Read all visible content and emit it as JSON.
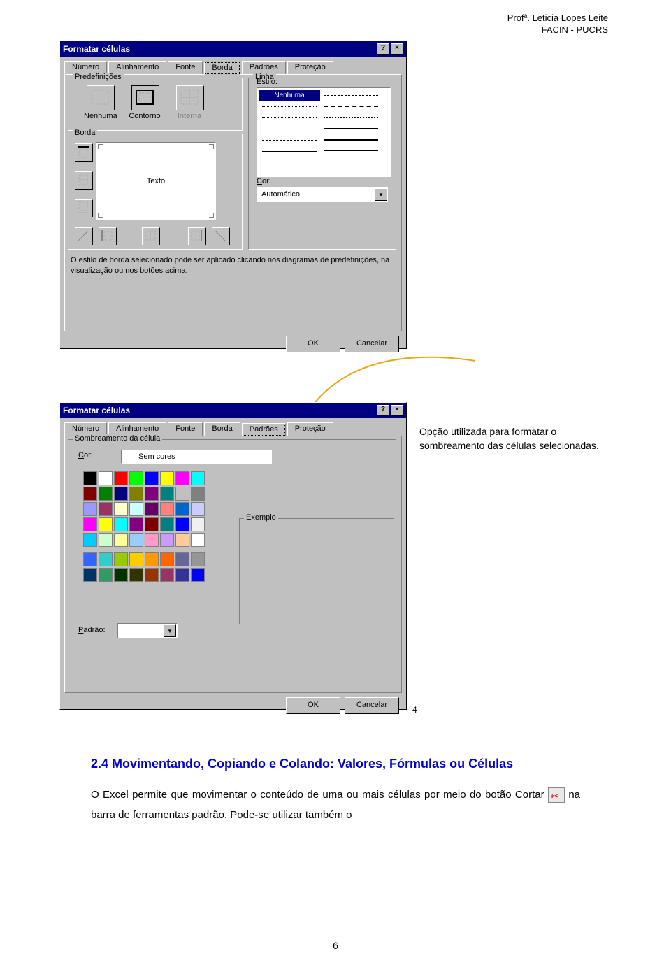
{
  "header": {
    "line1": "Profª. Leticia Lopes Leite",
    "line2": "FACIN - PUCRS"
  },
  "dialog1": {
    "title": "Formatar células",
    "tabs": [
      "Número",
      "Alinhamento",
      "Fonte",
      "Borda",
      "Padrões",
      "Proteção"
    ],
    "activeTab": "Borda",
    "grp_predef": "Predefinições",
    "presets": {
      "nenhuma": "Nenhuma",
      "contorno": "Contorno",
      "interna": "Interna"
    },
    "grp_borda": "Borda",
    "preview_text": "Texto",
    "grp_linha": "Linha",
    "lbl_estilo": "Estilo:",
    "style_none": "Nenhuma",
    "lbl_cor": "Cor:",
    "cor_value": "Automático",
    "hint": "O estilo de borda selecionado pode ser aplicado clicando nos diagramas de predefinições, na visualização ou nos botões acima.",
    "ok": "OK",
    "cancel": "Cancelar"
  },
  "dialog2": {
    "title": "Formatar células",
    "tabs": [
      "Número",
      "Alinhamento",
      "Fonte",
      "Borda",
      "Padrões",
      "Proteção"
    ],
    "activeTab": "Padrões",
    "grp_somb": "Sombreamento da célula",
    "lbl_cor": "Cor:",
    "semcores": "Sem cores",
    "lbl_padrao": "Padrão:",
    "grp_exemplo": "Exemplo",
    "ok": "OK",
    "cancel": "Cancelar",
    "palette": [
      [
        "#000000",
        "#ffffff",
        "#ff0000",
        "#00ff00",
        "#0000ff",
        "#ffff00",
        "#ff00ff",
        "#00ffff"
      ],
      [
        "#800000",
        "#008000",
        "#000080",
        "#808000",
        "#800080",
        "#008080",
        "#c0c0c0",
        "#808080"
      ],
      [
        "#9999ff",
        "#993366",
        "#ffffcc",
        "#ccffff",
        "#660066",
        "#ff8080",
        "#0066cc",
        "#ccccff"
      ],
      [
        "#ff00ff",
        "#ffff00",
        "#00ffff",
        "#800080",
        "#800000",
        "#008080",
        "#0000ff",
        "#f0f0f0"
      ],
      [
        "#00ccff",
        "#ccffcc",
        "#ffff99",
        "#99ccff",
        "#ff99cc",
        "#cc99ff",
        "#ffcc99",
        "#ffffff"
      ]
    ],
    "palette2": [
      [
        "#3366ff",
        "#33cccc",
        "#99cc00",
        "#ffcc00",
        "#ff9900",
        "#ff6600",
        "#666699",
        "#969696"
      ],
      [
        "#003366",
        "#339966",
        "#003300",
        "#333300",
        "#993300",
        "#993366",
        "#333399",
        "#0000ff"
      ]
    ]
  },
  "callout": "Opção utilizada para formatar o sombreamento das células selecionadas.",
  "footerNum": "4",
  "section": {
    "heading": "2.4  Movimentando, Copiando e Colando: Valores, Fórmulas ou Células",
    "para_a": "O Excel permite que movimentar o conteúdo de uma ou mais células por meio do botão Cortar ",
    "para_b": " na barra de ferramentas padrão. Pode-se utilizar também o"
  },
  "pageNumber": "6"
}
